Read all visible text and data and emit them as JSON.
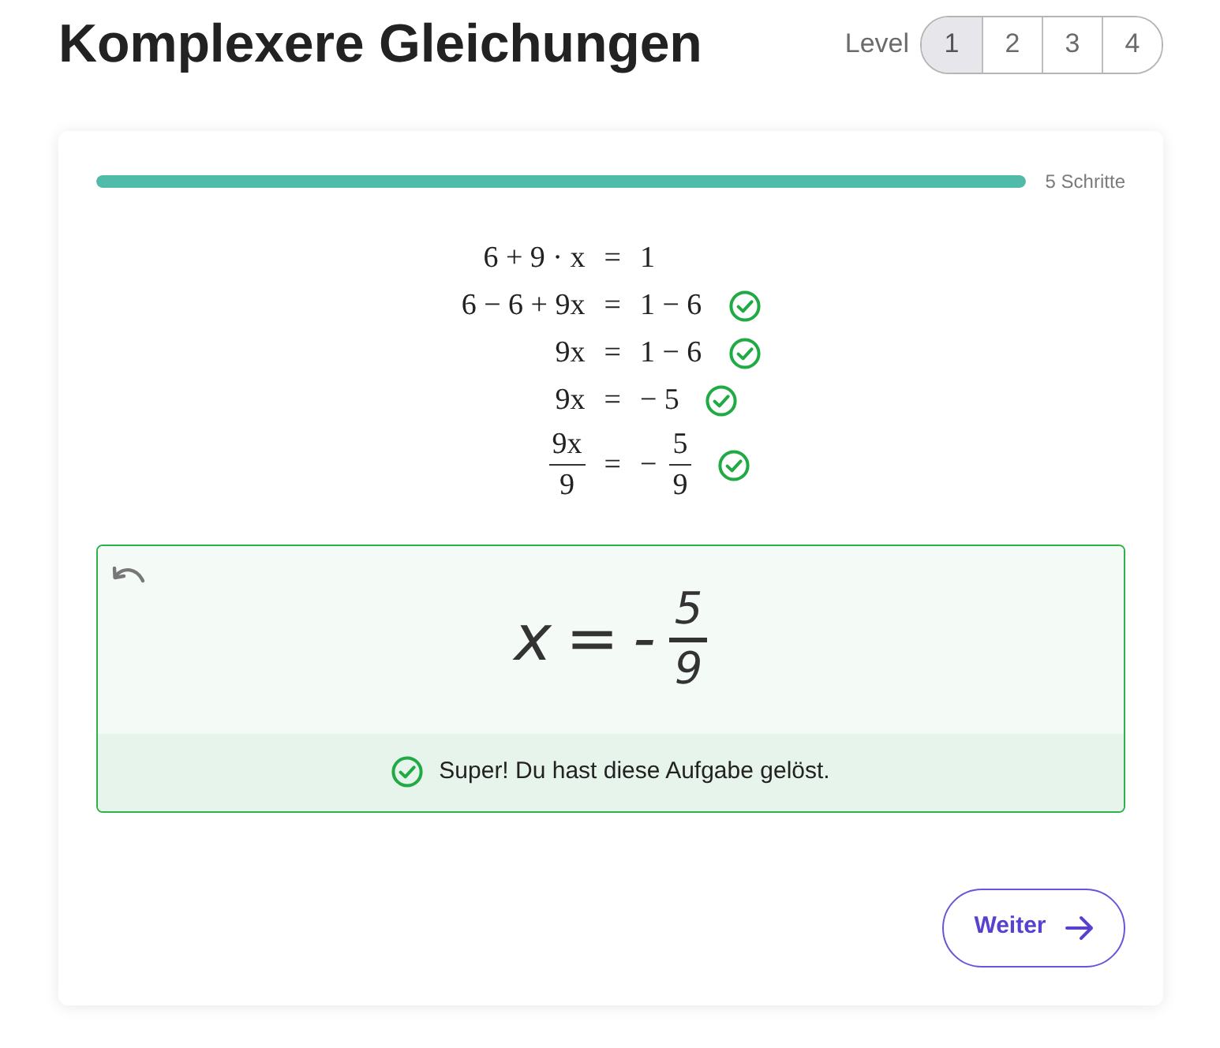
{
  "title": "Komplexere Gleichungen",
  "level_selector": {
    "label": "Level",
    "options": [
      {
        "label": "1",
        "selected": true
      },
      {
        "label": "2",
        "selected": false
      },
      {
        "label": "3",
        "selected": false
      },
      {
        "label": "4",
        "selected": false
      }
    ]
  },
  "progress": {
    "level": 1,
    "label": "5 Schritte"
  },
  "steps": [
    {
      "lhs": [
        {
          "kind": "text",
          "text": "6 + 9 · x"
        }
      ],
      "relation": "=",
      "rhs": [
        {
          "kind": "text",
          "text": "1"
        }
      ],
      "checked": false
    },
    {
      "lhs": [
        {
          "kind": "text",
          "text": "6 − 6 + 9x"
        }
      ],
      "relation": "=",
      "rhs": [
        {
          "kind": "text",
          "text": "1 − 6"
        }
      ],
      "checked": true
    },
    {
      "lhs": [
        {
          "kind": "text",
          "text": "9x"
        }
      ],
      "relation": "=",
      "rhs": [
        {
          "kind": "text",
          "text": "1 − 6"
        }
      ],
      "checked": true
    },
    {
      "lhs": [
        {
          "kind": "text",
          "text": "9x"
        }
      ],
      "relation": "=",
      "rhs": [
        {
          "kind": "text",
          "text": "− 5"
        }
      ],
      "checked": true
    },
    {
      "lhs": [
        {
          "kind": "frac",
          "num": "9x",
          "den": "9"
        }
      ],
      "relation": "=",
      "rhs": [
        {
          "kind": "text",
          "text": "−"
        },
        {
          "kind": "frac",
          "num": "5",
          "den": "9"
        }
      ],
      "checked": true
    }
  ],
  "answer": {
    "correct": true,
    "parts": [
      {
        "kind": "text",
        "text": "x"
      },
      {
        "kind": "text",
        "text": "="
      },
      {
        "kind": "text",
        "text": "-"
      },
      {
        "kind": "frac",
        "num": "5",
        "den": "9"
      }
    ],
    "feedback": "Super! Du hast diese Aufgabe gelöst."
  },
  "next_button": {
    "label": "Weiter"
  }
}
